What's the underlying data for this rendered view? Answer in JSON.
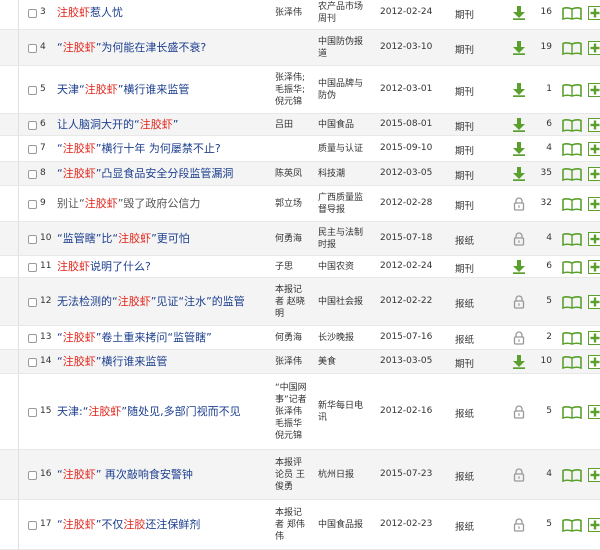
{
  "colors": {
    "keyword": "#e1251b",
    "link": "#1d3f8f",
    "icon_green": "#5aa02c",
    "lock_grey": "#999999"
  },
  "icons": {
    "download": "download-arrow-icon",
    "locked": "lock-icon",
    "read": "open-book-icon",
    "add": "plus-icon"
  },
  "rows": [
    {
      "num": "3",
      "title_parts": [
        {
          "t": "注胶虾",
          "hl": true
        },
        {
          "t": "惹人忧",
          "hl": false
        }
      ],
      "author": [
        "张泽伟"
      ],
      "source": [
        "农产品市场",
        "周刊"
      ],
      "date": "2012-02-24",
      "type": "期刊",
      "access": "download",
      "count": "16"
    },
    {
      "num": "4",
      "title_parts": [
        {
          "t": "“",
          "hl": false
        },
        {
          "t": "注胶虾",
          "hl": true
        },
        {
          "t": "”为何能在津长盛不衰?",
          "hl": false
        }
      ],
      "author": [],
      "source": [
        "中国防伪报",
        "道"
      ],
      "date": "2012-03-10",
      "type": "期刊",
      "access": "download",
      "count": "19"
    },
    {
      "num": "5",
      "title_parts": [
        {
          "t": "天津“",
          "hl": false
        },
        {
          "t": "注胶虾",
          "hl": true
        },
        {
          "t": "”横行谁来监管",
          "hl": false
        }
      ],
      "author": [
        "张泽伟;",
        "毛振华;",
        "倪元锦"
      ],
      "source": [
        "中国品牌与",
        "防伪"
      ],
      "date": "2012-03-01",
      "type": "期刊",
      "access": "download",
      "count": "1"
    },
    {
      "num": "6",
      "title_parts": [
        {
          "t": "让人脑洞大开的“",
          "hl": false
        },
        {
          "t": "注胶虾",
          "hl": true
        },
        {
          "t": "”",
          "hl": false
        }
      ],
      "author": [
        "吕田"
      ],
      "source": [
        "中国食品"
      ],
      "date": "2015-08-01",
      "type": "期刊",
      "access": "download",
      "count": "6"
    },
    {
      "num": "7",
      "title_parts": [
        {
          "t": "“",
          "hl": false
        },
        {
          "t": "注胶虾",
          "hl": true
        },
        {
          "t": "”横行十年 为何屡禁不止?",
          "hl": false
        }
      ],
      "author": [],
      "source": [
        "质量与认证"
      ],
      "date": "2015-09-10",
      "type": "期刊",
      "access": "download",
      "count": "4"
    },
    {
      "num": "8",
      "title_parts": [
        {
          "t": "“",
          "hl": false
        },
        {
          "t": "注胶虾",
          "hl": true
        },
        {
          "t": "”凸显食品安全分段监管漏洞",
          "hl": false
        }
      ],
      "author": [
        "陈英凤"
      ],
      "source": [
        "科技潮"
      ],
      "date": "2012-03-05",
      "type": "期刊",
      "access": "download",
      "count": "35"
    },
    {
      "num": "9",
      "title_parts": [
        {
          "t": "别让“",
          "hl": false
        },
        {
          "t": "注胶虾",
          "hl": true
        },
        {
          "t": "”毁了政府公信力",
          "hl": false
        }
      ],
      "author": [
        "郭立场"
      ],
      "source": [
        "广西质量监",
        "督导报"
      ],
      "date": "2012-02-28",
      "type": "期刊",
      "access": "locked",
      "count": "32",
      "grey": true
    },
    {
      "num": "10",
      "title_parts": [
        {
          "t": "“监管瞎”比“",
          "hl": false
        },
        {
          "t": "注胶虾",
          "hl": true
        },
        {
          "t": "”更可怕",
          "hl": false
        }
      ],
      "author": [
        "何勇海"
      ],
      "source": [
        "民主与法制",
        "时报"
      ],
      "date": "2015-07-18",
      "type": "报纸",
      "access": "locked",
      "count": "4"
    },
    {
      "num": "11",
      "title_parts": [
        {
          "t": "注胶虾",
          "hl": true
        },
        {
          "t": "说明了什么?",
          "hl": false
        }
      ],
      "author": [
        "子思"
      ],
      "source": [
        "中国农资"
      ],
      "date": "2012-02-24",
      "type": "期刊",
      "access": "download",
      "count": "6"
    },
    {
      "num": "12",
      "title_parts": [
        {
          "t": "无法检测的“",
          "hl": false
        },
        {
          "t": "注胶虾",
          "hl": true
        },
        {
          "t": "”见证“注水”的监管",
          "hl": false
        }
      ],
      "author": [
        "本报记",
        "者 赵晓",
        "明"
      ],
      "source": [
        "中国社会报"
      ],
      "date": "2012-02-22",
      "type": "报纸",
      "access": "locked",
      "count": "5"
    },
    {
      "num": "13",
      "title_parts": [
        {
          "t": "“",
          "hl": false
        },
        {
          "t": "注胶虾",
          "hl": true
        },
        {
          "t": "”卷土重来拷问“监管瞎”",
          "hl": false
        }
      ],
      "author": [
        "何勇海"
      ],
      "source": [
        "长沙晚报"
      ],
      "date": "2015-07-16",
      "type": "报纸",
      "access": "locked",
      "count": "2"
    },
    {
      "num": "14",
      "title_parts": [
        {
          "t": "“",
          "hl": false
        },
        {
          "t": "注胶虾",
          "hl": true
        },
        {
          "t": "”横行谁来监管",
          "hl": false
        }
      ],
      "author": [
        "张泽伟"
      ],
      "source": [
        "美食"
      ],
      "date": "2013-03-05",
      "type": "期刊",
      "access": "download",
      "count": "10"
    },
    {
      "num": "15",
      "title_parts": [
        {
          "t": "天津:“",
          "hl": false
        },
        {
          "t": "注胶虾",
          "hl": true
        },
        {
          "t": "”随处见,多部门视而不见",
          "hl": false
        }
      ],
      "author": [
        "“中国网",
        "事”记者",
        "张泽伟",
        "毛振华",
        "倪元锦"
      ],
      "source": [
        "新华每日电",
        "讯"
      ],
      "date": "2012-02-16",
      "type": "报纸",
      "access": "locked",
      "count": "5"
    },
    {
      "num": "16",
      "title_parts": [
        {
          "t": "“",
          "hl": false
        },
        {
          "t": "注胶虾",
          "hl": true
        },
        {
          "t": "” 再次敲响食安警钟",
          "hl": false
        }
      ],
      "author": [
        "本报评",
        "论员 王",
        "俊勇"
      ],
      "source": [
        "杭州日报"
      ],
      "date": "2015-07-23",
      "type": "报纸",
      "access": "locked",
      "count": "4"
    },
    {
      "num": "17",
      "title_parts": [
        {
          "t": "“",
          "hl": false
        },
        {
          "t": "注胶虾",
          "hl": true
        },
        {
          "t": "”不仅",
          "hl": false
        },
        {
          "t": "注胶",
          "hl": true
        },
        {
          "t": "还注保鲜剂",
          "hl": false
        }
      ],
      "author": [
        "本报记",
        "者 郑伟",
        "伟"
      ],
      "source": [
        "中国食品报"
      ],
      "date": "2012-02-23",
      "type": "报纸",
      "access": "locked",
      "count": "5"
    }
  ]
}
